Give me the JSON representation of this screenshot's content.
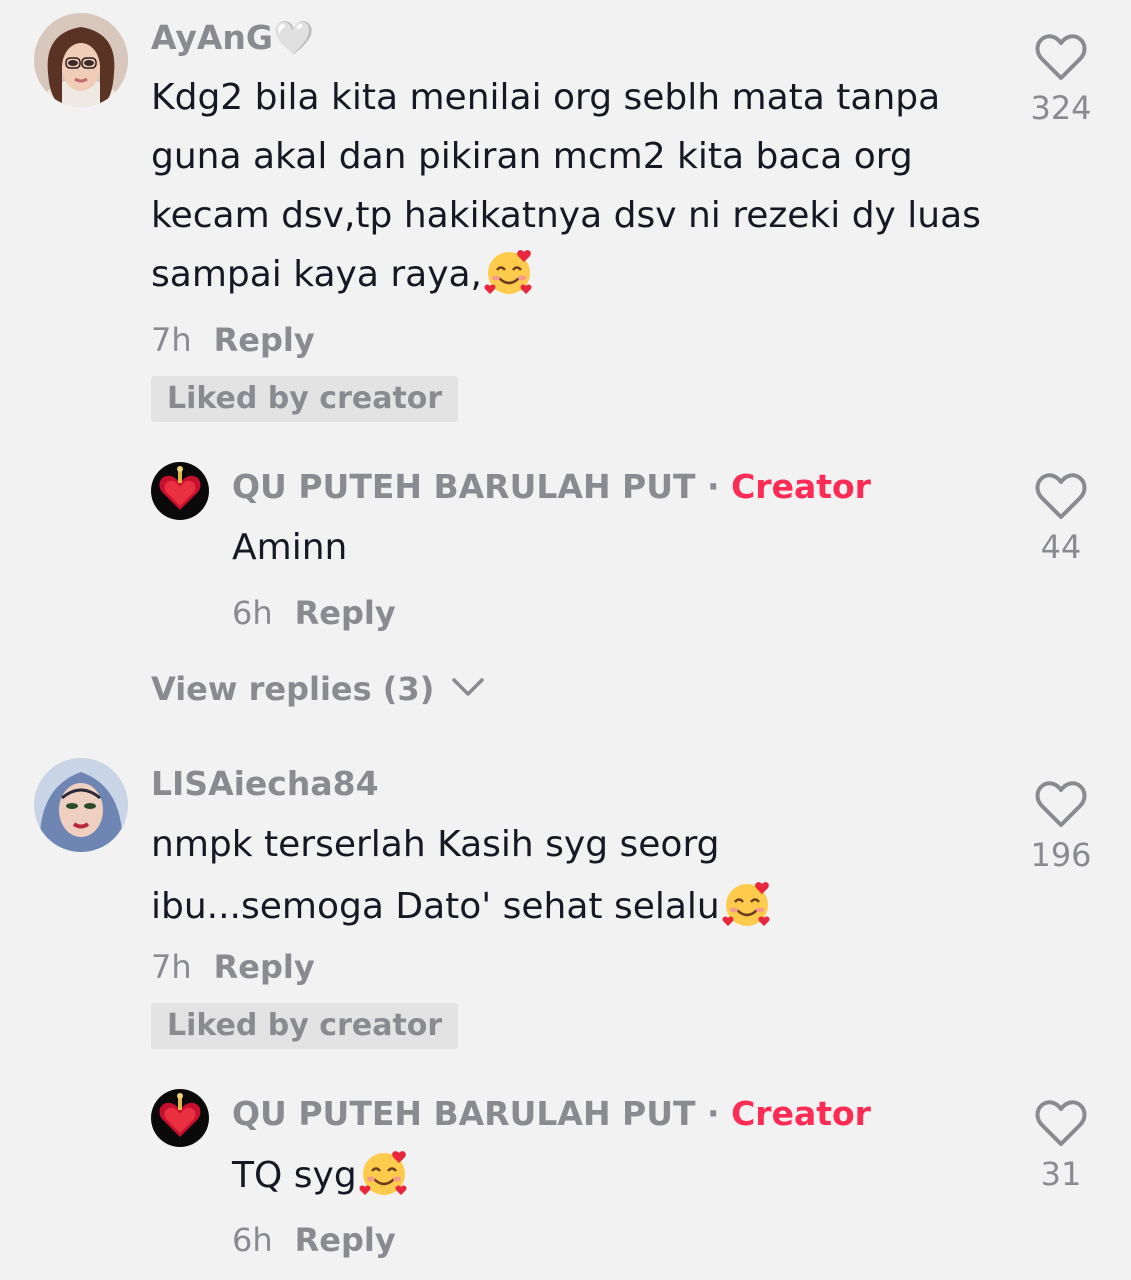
{
  "comments": [
    {
      "username": "AyAnG🤍",
      "text": "Kdg2 bila kita menilai org seblh mata tanpa guna akal dan pikiran mcm2 kita baca org kecam dsv,tp hakikatnya dsv ni rezeki dy luas sampai kaya raya,",
      "time": "7h",
      "reply_label": "Reply",
      "liked_by_creator": "Liked by creator",
      "like_count": "324",
      "reply": {
        "username": "QU PUTEH BARULAH PUT",
        "separator": "·",
        "creator_tag": "Creator",
        "text": "Aminn",
        "time": "6h",
        "reply_label": "Reply",
        "like_count": "44"
      },
      "view_replies": "View replies (3)"
    },
    {
      "username": "LISAiecha84",
      "text_line1": "nmpk terserlah Kasih syg seorg",
      "text_line2": "ibu...semoga Dato' sehat selalu",
      "time": "7h",
      "reply_label": "Reply",
      "liked_by_creator": "Liked by creator",
      "like_count": "196",
      "reply": {
        "username": "QU PUTEH BARULAH PUT",
        "separator": "·",
        "creator_tag": "Creator",
        "text": "TQ syg",
        "time": "6h",
        "reply_label": "Reply",
        "like_count": "31"
      }
    }
  ],
  "colors": {
    "background": "#f2f2f2",
    "text": "#161823",
    "secondary": "#8a8b91",
    "creator": "#fe2c55",
    "badge": "#e3e3e4"
  },
  "icons": {
    "like": "heart-outline-icon",
    "expand": "chevron-down-icon",
    "emoji": "smiling-face-with-hearts-emoji"
  }
}
